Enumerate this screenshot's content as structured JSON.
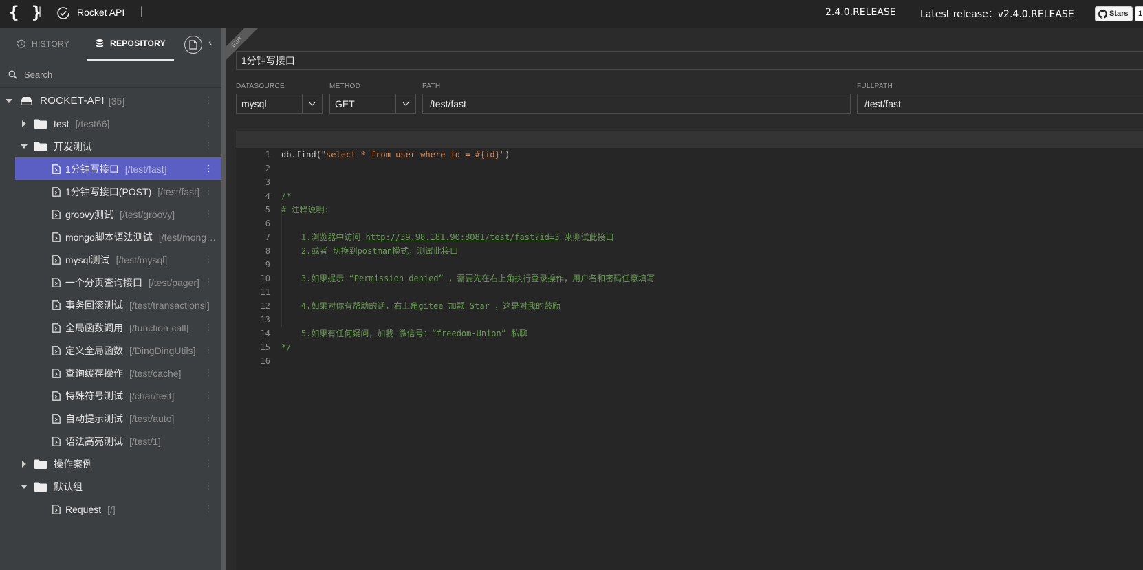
{
  "topbar": {
    "logo": "{ }",
    "separator": "|",
    "brand": "Rocket API",
    "version": "2.4.0.RELEASE",
    "latest_release": "Latest release：v2.4.0.RELEASE",
    "stars_label": "Stars",
    "stars_count": "1"
  },
  "sidebar": {
    "tabs": {
      "history": "HISTORY",
      "repository": "REPOSITORY"
    },
    "search_placeholder": "Search",
    "root": {
      "label": "ROCKET-API",
      "count": "[35]"
    },
    "groups": [
      {
        "name": "test",
        "path": "[/test66]"
      },
      {
        "name": "开发测试"
      },
      {
        "name": "操作案例"
      },
      {
        "name": "默认组"
      }
    ],
    "apis": [
      {
        "name": "1分钟写接口",
        "path": "[/test/fast]"
      },
      {
        "name": "1分钟写接口(POST)",
        "path": "[/test/fast]"
      },
      {
        "name": "groovy测试",
        "path": "[/test/groovy]"
      },
      {
        "name": "mongo脚本语法测试",
        "path": "[/test/mong…"
      },
      {
        "name": "mysql测试",
        "path": "[/test/mysql]"
      },
      {
        "name": "一个分页查询接口",
        "path": "[/test/pager]"
      },
      {
        "name": "事务回滚测试",
        "path": "[/test/transactionsl]"
      },
      {
        "name": "全局函数调用",
        "path": "[/function-call]"
      },
      {
        "name": "定义全局函数",
        "path": "[/DingDingUtils]"
      },
      {
        "name": "查询缓存操作",
        "path": "[/test/cache]"
      },
      {
        "name": "特殊符号测试",
        "path": "[/char/test]"
      },
      {
        "name": "自动提示测试",
        "path": "[/test/auto]"
      },
      {
        "name": "语法高亮测试",
        "path": "[/test/1]"
      },
      {
        "name": "Request",
        "path": "[/]"
      }
    ]
  },
  "editor": {
    "ribbon": "EDIT",
    "title": "1分钟写接口",
    "datasource_label": "DATASOURCE",
    "datasource_value": "mysql",
    "method_label": "METHOD",
    "method_value": "GET",
    "path_label": "PATH",
    "path_value": "/test/fast",
    "fullpath_label": "FULLPATH",
    "fullpath_value": "/test/fast",
    "code": {
      "l1_fn": "db.find(",
      "l1_str": "\"select * from user where id = #{id}\"",
      "l1_end": ")",
      "l4": "/*",
      "l5": "# 注释说明:",
      "l7_a": "    1.浏览器中访问 ",
      "l7_link": "http://39.98.181.90:8081/test/fast?id=3",
      "l7_b": " 来测试此接口",
      "l8": "    2.或者 切换到postman模式，测试此接口",
      "l10": "    3.如果提示 “Permission denied” ，需要先在右上角执行登录操作，用户名和密码任意填写",
      "l12": "    4.如果对你有帮助的话，右上角gitee 加颗 Star ，这是对我的鼓励",
      "l14": "    5.如果有任何疑问，加我 微信号：“freedom-Union” 私聊",
      "l15": "*/"
    },
    "line_numbers": [
      "1",
      "2",
      "3",
      "4",
      "5",
      "6",
      "7",
      "8",
      "9",
      "10",
      "11",
      "12",
      "13",
      "14",
      "15",
      "16"
    ]
  }
}
